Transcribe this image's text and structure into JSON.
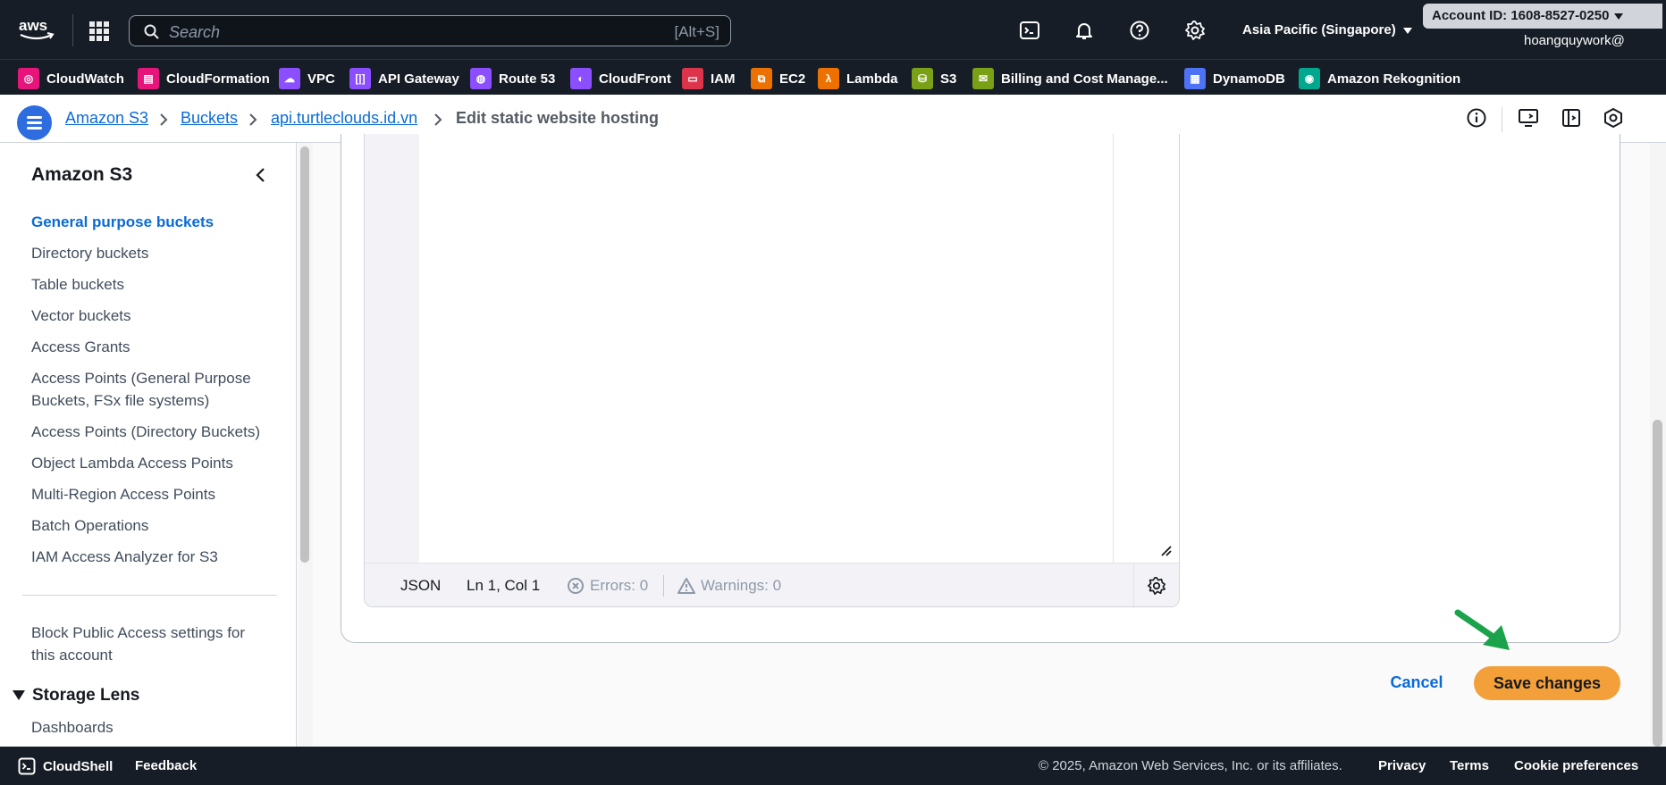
{
  "topnav": {
    "search_placeholder": "Search",
    "search_shortcut": "[Alt+S]",
    "region": "Asia Pacific (Singapore)",
    "account_id": "Account ID: 1608-8527-0250",
    "username": "hoangquywork@"
  },
  "favorites": [
    {
      "label": "CloudWatch",
      "color": "#e7157b"
    },
    {
      "label": "CloudFormation",
      "color": "#e7157b"
    },
    {
      "label": "VPC",
      "color": "#8c4fff"
    },
    {
      "label": "API Gateway",
      "color": "#8c4fff"
    },
    {
      "label": "Route 53",
      "color": "#8c4fff"
    },
    {
      "label": "CloudFront",
      "color": "#8c4fff"
    },
    {
      "label": "IAM",
      "color": "#dd344c"
    },
    {
      "label": "EC2",
      "color": "#ed7100"
    },
    {
      "label": "Lambda",
      "color": "#ed7100"
    },
    {
      "label": "S3",
      "color": "#7aa116"
    },
    {
      "label": "Billing and Cost Manage...",
      "color": "#7aa116"
    },
    {
      "label": "DynamoDB",
      "color": "#4d72f3"
    },
    {
      "label": "Amazon Rekognition",
      "color": "#01a88d"
    }
  ],
  "breadcrumb": {
    "items": [
      "Amazon S3",
      "Buckets",
      "api.turtleclouds.id.vn"
    ],
    "current": "Edit static website hosting"
  },
  "sidebar": {
    "title": "Amazon S3",
    "items": [
      "General purpose buckets",
      "Directory buckets",
      "Table buckets",
      "Vector buckets",
      "Access Grants",
      "Access Points (General Purpose Buckets, FSx file systems)",
      "Access Points (Directory Buckets)",
      "Object Lambda Access Points",
      "Multi-Region Access Points",
      "Batch Operations",
      "IAM Access Analyzer for S3"
    ],
    "block_public": "Block Public Access settings for this account",
    "section": "Storage Lens",
    "section_items": [
      "Dashboards"
    ]
  },
  "editor": {
    "language": "JSON",
    "position": "Ln 1, Col 1",
    "errors": "Errors: 0",
    "warnings": "Warnings: 0"
  },
  "actions": {
    "cancel": "Cancel",
    "save": "Save changes"
  },
  "footer": {
    "cloudshell": "CloudShell",
    "feedback": "Feedback",
    "copyright": "© 2025, Amazon Web Services, Inc. or its affiliates.",
    "privacy": "Privacy",
    "terms": "Terms",
    "cookies": "Cookie preferences"
  },
  "colors": {
    "nav_bg": "#161d26",
    "link": "#0a6bd6",
    "primary_button": "#f3a03a",
    "annotation_arrow": "#1aa34a"
  }
}
